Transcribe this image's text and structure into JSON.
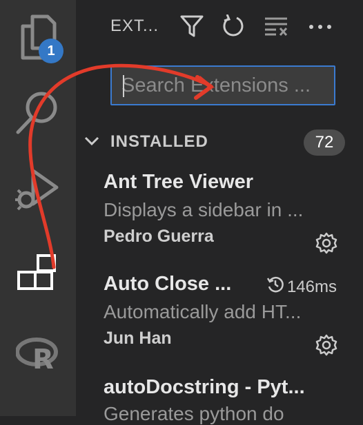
{
  "activity_bar": {
    "explorer_badge": "1",
    "items": [
      "explorer-icon",
      "search-icon",
      "run-debug-icon",
      "extensions-icon",
      "r-icon"
    ]
  },
  "sidebar": {
    "title": "EXT...",
    "toolbar_icons": [
      "filter-icon",
      "refresh-icon",
      "clear-extensions-icon",
      "more-actions-icon"
    ],
    "search": {
      "placeholder": "Search Extensions ...",
      "value": ""
    },
    "section": {
      "label": "INSTALLED",
      "count": "72"
    },
    "extensions": [
      {
        "name": "Ant Tree Viewer",
        "description": "Displays a sidebar in ...",
        "publisher": "Pedro Guerra"
      },
      {
        "name": "Auto Close ...",
        "timing": "146ms",
        "description": "Automatically add HT...",
        "publisher": "Jun Han"
      },
      {
        "name": "autoDocstring - Pyt...",
        "description": "Generates python do"
      }
    ]
  },
  "colors": {
    "accent": "#3478c6",
    "annotation_arrow": "#e23b2a"
  }
}
